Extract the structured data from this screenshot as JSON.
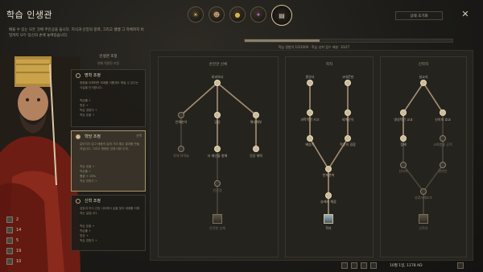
{
  "header": {
    "title": "학습 인생관",
    "subtitle": "배울 수 있는 모든 것에 주인공을 둡니다. 지식과 신앙의 봉력, 그리고 쌩쌩 그 자체까지 비밀까지 모두 당신의 손에 놓여있습니다.",
    "tabs": [
      {
        "name": "tab-1",
        "icon": "sun-icon"
      },
      {
        "name": "tab-2",
        "icon": "person-icon"
      },
      {
        "name": "tab-3",
        "icon": "coin-icon"
      },
      {
        "name": "tab-4",
        "icon": "potion-icon"
      },
      {
        "name": "tab-5",
        "icon": "book-icon"
      }
    ],
    "active_tab": 4,
    "reset_label": "상태 초기화",
    "close_icon": "✕"
  },
  "progress": {
    "fraction": 0.36,
    "text": "학습 경험치 10/1000 · 학습 성취 점수 배분: 10/27"
  },
  "left_panel": {
    "heading": "인생관 조정",
    "subheading": "현재 적용된 조정",
    "cards": [
      {
        "title": "명학 조정",
        "desc": "명령을 이해하면 세계를 이롭게도 해칠 수 있다는 사실을 인식합니다.",
        "lines": [
          "학습률 +",
          "명성 +",
          "학습 경험치 +",
          "학습 효율 +"
        ]
      },
      {
        "title": "학당 조정",
        "tag": "선택",
        "desc": "같아지지 않고 배움의 길에 기대 좋은 결과를 만들어냅니다. 그리고 명령한 것에 대한 무게.",
        "lines": [
          "학습 효율 +",
          "학습률 +",
          "명성 + 15%",
          "학습 경험치 +"
        ]
      },
      {
        "title": "신학 조정",
        "desc": "성장과 지식 신앙 사이에서 길을 찾아 세계를 이해하는 길입니다.",
        "lines": [
          "학습 효율 +",
          "학습률 +",
          "명성 +",
          "학습 경험치 +"
        ]
      }
    ]
  },
  "stats": [
    {
      "icon": "diplomacy-icon",
      "value": "2"
    },
    {
      "icon": "martial-icon",
      "value": "14"
    },
    {
      "icon": "stewardship-icon",
      "value": "5"
    },
    {
      "icon": "intrigue-icon",
      "value": "19"
    },
    {
      "icon": "learning-icon",
      "value": "10"
    }
  ],
  "tree": {
    "columns": [
      {
        "title": "온전한 신체"
      },
      {
        "title": "학자"
      },
      {
        "title": "신학자"
      }
    ],
    "nodes": [
      {
        "id": "a1",
        "label": "외과의사"
      },
      {
        "id": "a2",
        "label": "인체분석"
      },
      {
        "id": "a3",
        "label": "임상"
      },
      {
        "id": "a4",
        "label": "해부해부"
      },
      {
        "id": "a5",
        "label": "육체 역학술"
      },
      {
        "id": "a6",
        "label": "더 제인을 향해"
      },
      {
        "id": "a7",
        "label": "건강 체력"
      },
      {
        "id": "a8",
        "label": "인간경"
      },
      {
        "id": "a9",
        "label": "온전한 신체"
      },
      {
        "id": "b1",
        "label": "필경사"
      },
      {
        "id": "b2",
        "label": "고대문헌"
      },
      {
        "id": "b3",
        "label": "과학적인 사고"
      },
      {
        "id": "b4",
        "label": "세계인식"
      },
      {
        "id": "b5",
        "label": "배움학"
      },
      {
        "id": "b6",
        "label": "학문의 길잡"
      },
      {
        "id": "b7",
        "label": "천체관측"
      },
      {
        "id": "b8",
        "label": "숭배로 채움"
      },
      {
        "id": "b9",
        "label": "학자"
      },
      {
        "id": "c1",
        "label": "설교자"
      },
      {
        "id": "c2",
        "label": "영성적인 교교"
      },
      {
        "id": "c3",
        "label": "신의의 효교"
      },
      {
        "id": "c4",
        "label": "참배"
      },
      {
        "id": "c5",
        "label": "교회법을 공적"
      },
      {
        "id": "c6",
        "label": "신비지"
      },
      {
        "id": "c7",
        "label": "권위인"
      },
      {
        "id": "c8",
        "label": "성경사해교조"
      },
      {
        "id": "c9",
        "label": "신학자"
      }
    ]
  },
  "footer": {
    "date": "10월 1일, 1178 AD",
    "icons": [
      "calendar-icon",
      "speed-icon",
      "pause-icon",
      "fast-icon",
      "menu-icon"
    ]
  },
  "colors": {
    "accent": "#d8c59a",
    "panel": "#26241f",
    "text": "#cfc6b4"
  }
}
